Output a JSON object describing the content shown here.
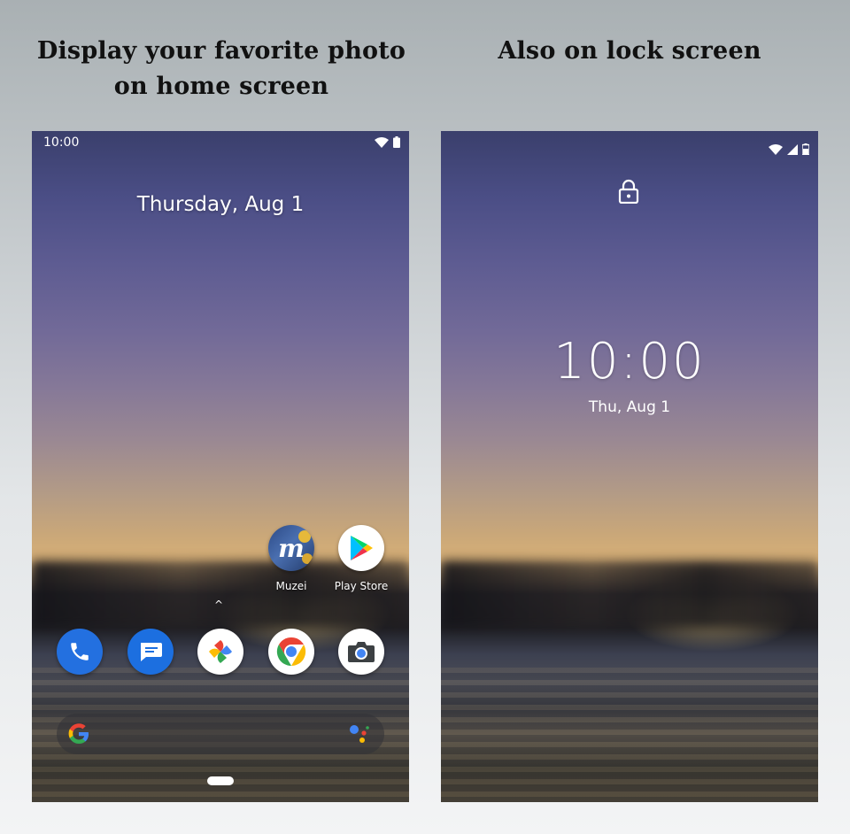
{
  "captions": {
    "left": "Display your favorite photo on home screen",
    "right": "Also on lock screen"
  },
  "home_screen": {
    "status_time": "10:00",
    "date": "Thursday, Aug 1",
    "apps": [
      {
        "label": "Muzei",
        "icon": "muzei-icon"
      },
      {
        "label": "Play Store",
        "icon": "play-store-icon"
      }
    ],
    "dock": [
      {
        "icon": "phone-icon"
      },
      {
        "icon": "messages-icon"
      },
      {
        "icon": "photos-icon"
      },
      {
        "icon": "chrome-icon"
      },
      {
        "icon": "camera-icon"
      }
    ],
    "swipe_indicator": "^",
    "search": {
      "icon": "google-g-icon",
      "assistant_icon": "assistant-icon"
    }
  },
  "lock_screen": {
    "time": "10:00",
    "date": "Thu, Aug 1"
  }
}
